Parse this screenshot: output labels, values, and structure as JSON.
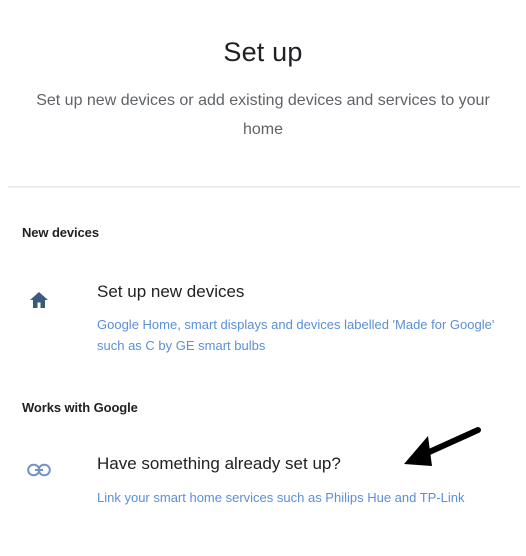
{
  "header": {
    "title": "Set up",
    "subtitle": "Set up new devices or add existing devices and services to your home"
  },
  "sections": [
    {
      "label": "New devices",
      "item": {
        "icon": "home-icon",
        "title": "Set up new devices",
        "description": "Google Home, smart displays and devices labelled 'Made for Google' such as C by GE smart bulbs"
      }
    },
    {
      "label": "Works with Google",
      "item": {
        "icon": "link-icon",
        "title": "Have something already set up?",
        "description": "Link your smart home services such as Philips Hue and TP-Link"
      }
    }
  ],
  "colors": {
    "accent": "#5b8fd6",
    "icon_home": "#3c5a7a",
    "icon_link": "#6f93c9",
    "annotation_arrow": "#000000"
  }
}
